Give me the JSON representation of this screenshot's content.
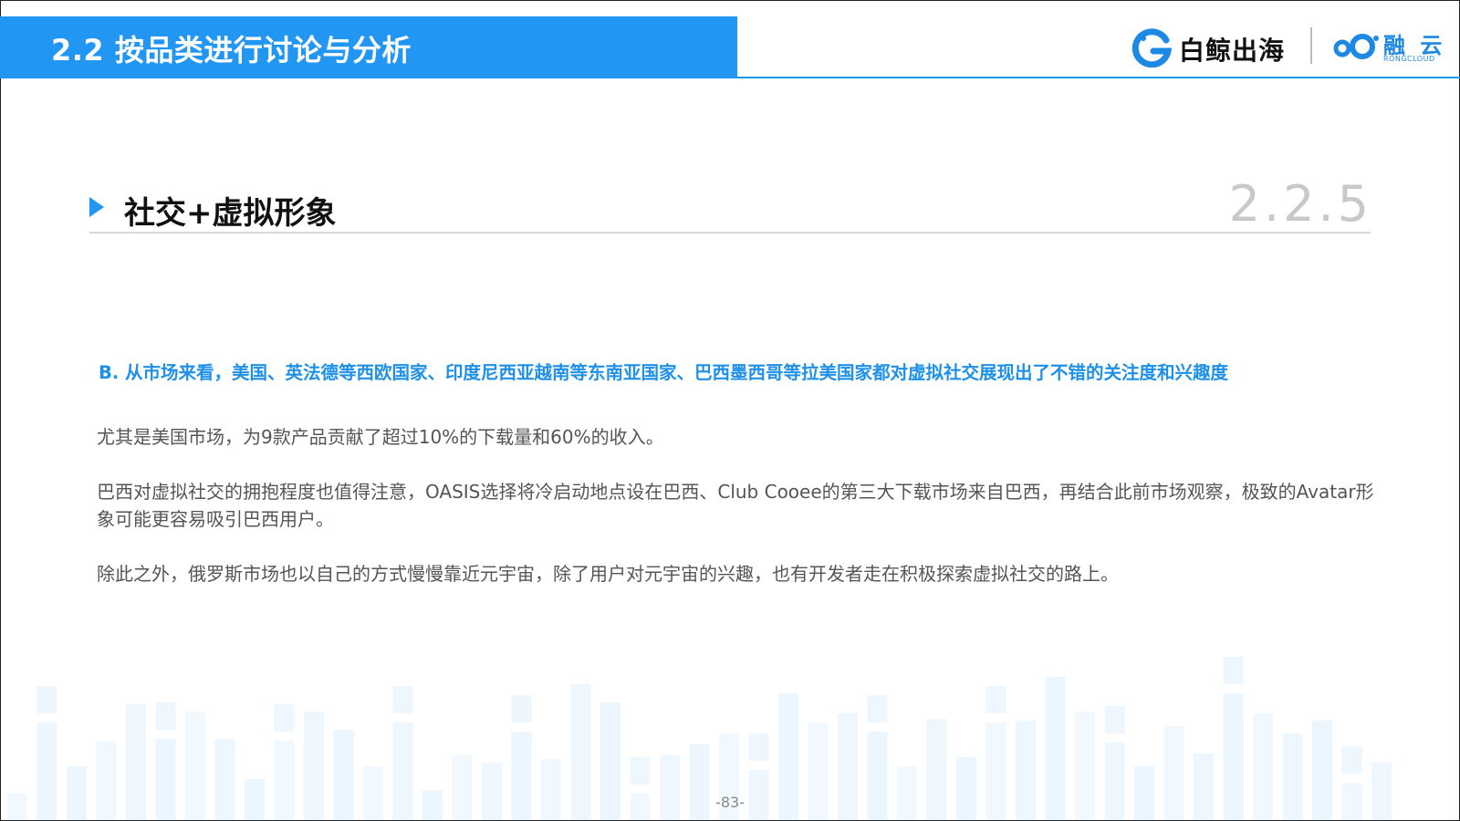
{
  "header": {
    "title": "2.2 按品类进行讨论与分析",
    "brand_primary": "白鲸出海",
    "brand_secondary": "融 云",
    "brand_secondary_sub": "RONGCLOUD",
    "accent_color": "#2196f3"
  },
  "section": {
    "title": "社交+虚拟形象",
    "number": "2.2.5"
  },
  "body": {
    "highlight": "B. 从市场来看，美国、英法德等西欧国家、印度尼西亚越南等东南亚国家、巴西墨西哥等拉美国家都对虚拟社交展现出了不错的关注度和兴趣度",
    "paragraphs": [
      "尤其是美国市场，为9款产品贡献了超过10%的下载量和60%的收入。",
      "巴西对虚拟社交的拥抱程度也值得注意，OASIS选择将冷启动地点设在巴西、Club Cooee的第三大下载市场来自巴西，再结合此前市场观察，极致的Avatar形象可能更容易吸引巴西用户。",
      "除此之外，俄罗斯市场也以自己的方式慢慢靠近元宇宙，除了用户对元宇宙的兴趣，也有开发者走在积极探索虚拟社交的路上。"
    ]
  },
  "footer": {
    "page_number": "-83-"
  }
}
